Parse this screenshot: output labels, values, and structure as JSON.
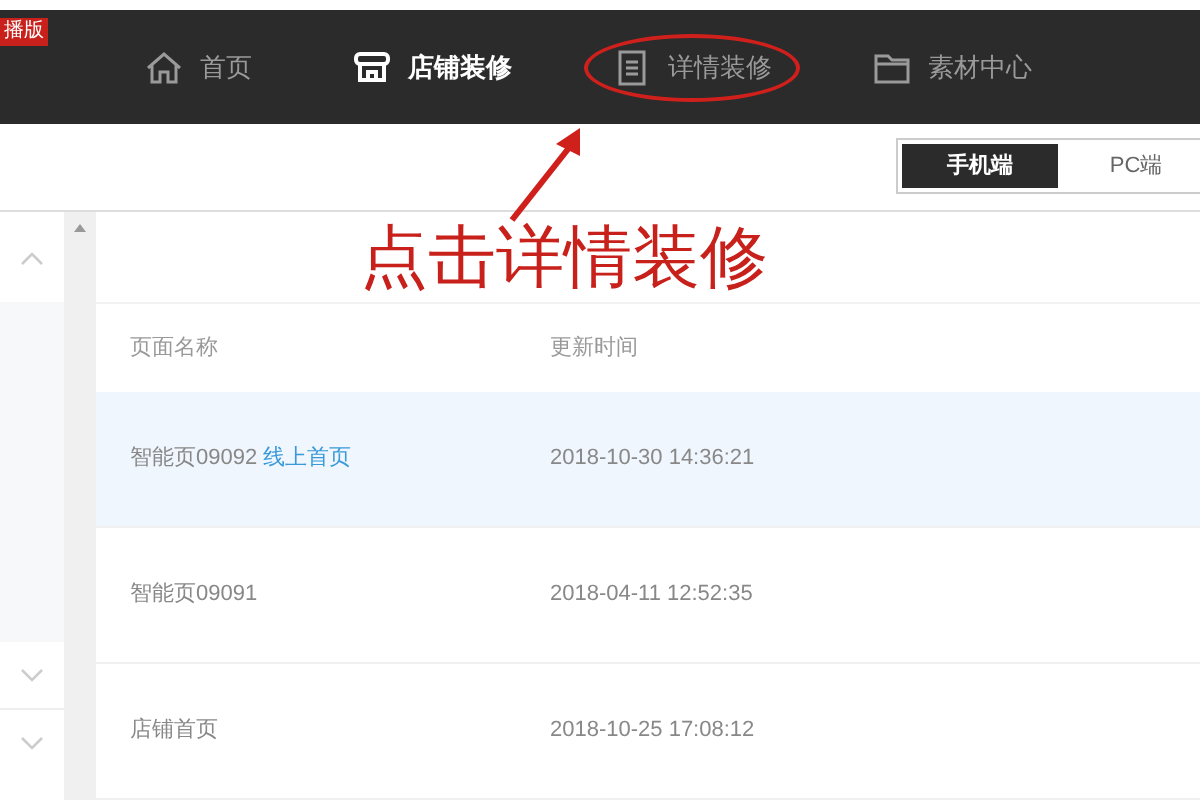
{
  "edition_badge": "播版",
  "nav": [
    {
      "label": "首页",
      "selected": false,
      "circled": false
    },
    {
      "label": "店铺装修",
      "selected": true,
      "circled": false
    },
    {
      "label": "详情装修",
      "selected": false,
      "circled": true
    },
    {
      "label": "素材中心",
      "selected": false,
      "circled": false
    }
  ],
  "device_toggle": [
    {
      "label": "手机端",
      "selected": true
    },
    {
      "label": "PC端",
      "selected": false
    }
  ],
  "annotation": "点击详情装修",
  "table": {
    "columns": [
      "页面名称",
      "更新时间"
    ],
    "rows": [
      {
        "name": "智能页09092",
        "tag": "线上首页",
        "time": "2018-10-30 14:36:21",
        "selected": true
      },
      {
        "name": "智能页09091",
        "time": "2018-04-11 12:52:35",
        "selected": false
      },
      {
        "name": "店铺首页",
        "time": "2018-10-25 17:08:12",
        "selected": false
      }
    ]
  }
}
